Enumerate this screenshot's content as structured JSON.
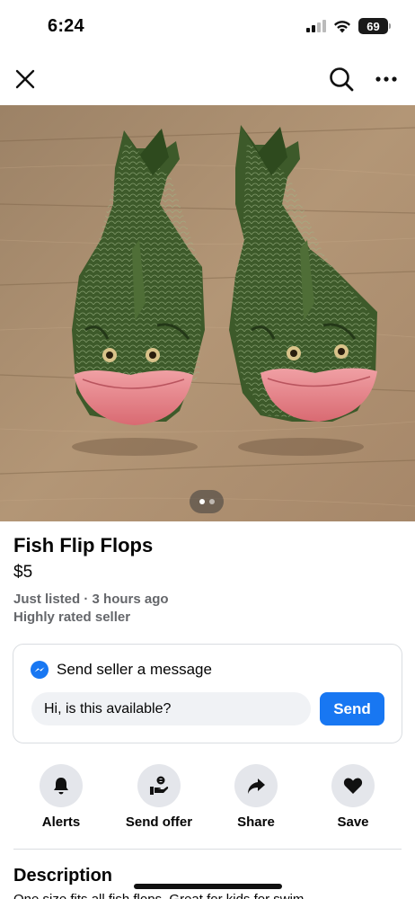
{
  "status_bar": {
    "time": "6:24",
    "battery": "69"
  },
  "nav": {
    "close_icon": "close-icon",
    "search_icon": "search-icon",
    "more_icon": "more-icon"
  },
  "hero": {
    "image_count": 2,
    "active_index": 0
  },
  "listing": {
    "title": "Fish Flip Flops",
    "price": "$5",
    "listed": "Just listed · 3 hours ago",
    "seller": "Highly rated seller"
  },
  "message": {
    "header": "Send seller a message",
    "input_value": "Hi, is this available?",
    "send_label": "Send"
  },
  "actions": [
    {
      "label": "Alerts",
      "icon": "bell-icon"
    },
    {
      "label": "Send offer",
      "icon": "offer-icon"
    },
    {
      "label": "Share",
      "icon": "share-icon"
    },
    {
      "label": "Save",
      "icon": "heart-icon"
    }
  ],
  "description": {
    "title": "Description",
    "text": "One size fits all fish flops. Great for kids for swim"
  },
  "colors": {
    "accent": "#1877f2",
    "secondary_text": "#65676b",
    "action_bg": "#e4e6eb"
  }
}
